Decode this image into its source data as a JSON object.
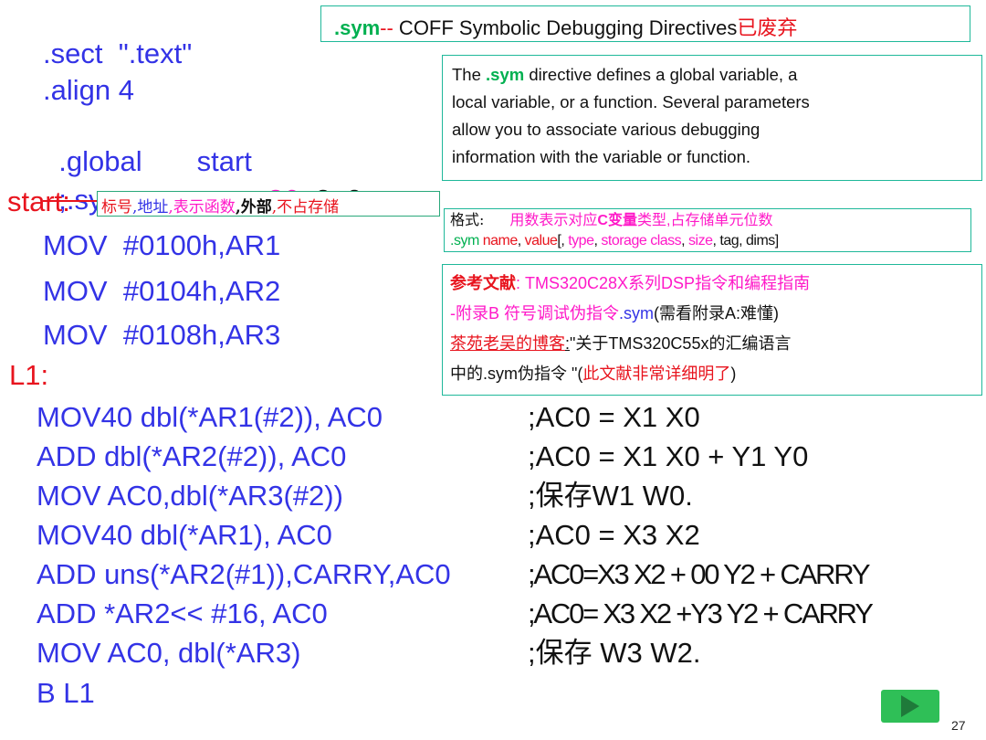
{
  "title_box": {
    "keyword": ".sym",
    "sep": "--",
    "text": " COFF Symbolic Debugging Directives",
    "note": "已废弃"
  },
  "code_top": {
    "sect": ".sect  \".text\"",
    "align": ".align 4",
    "global_kw": ".global",
    "global_arg": "start",
    "sym_kw": ";.sym ",
    "sym_name": "start",
    "sym_c1": ",",
    "sym_value": "start",
    "sym_c2": ", ",
    "sym_type": "36",
    "sym_rest": ", 2, 0"
  },
  "start_label": "start:",
  "annot": {
    "a1": "标号",
    "a2": ",地址",
    "a3": ",表示函数",
    "a4": ",外部",
    "a5": ",不占存储"
  },
  "desc_box": {
    "l1a": "The ",
    "l1k": ".sym",
    "l1b": " directive defines a global variable, a",
    "l2": "local variable, or a function. Several parameters",
    "l3": "allow you to associate various debugging",
    "l4": "information with the variable or function."
  },
  "format_box": {
    "label": "格式:",
    "hint_a": "用数表示对应",
    "hint_b": "C变量",
    "hint_c": "类型",
    "hint_d": ",占存储单元位数",
    "syn_a": ".sym ",
    "syn_b": "name",
    "syn_c": ", ",
    "syn_d": "value",
    "syn_e": "[, ",
    "syn_f": "type",
    "syn_g": ", ",
    "syn_h": "storage class",
    "syn_i": ", ",
    "syn_j": "size",
    "syn_k": ", tag, dims]"
  },
  "ref_box": {
    "r1a": "参考文献",
    "r1b": ": TMS320C28X系列DSP指令和编程指南",
    "r2a": "-附录B 符号调试伪指令",
    "r2b": ".sym",
    "r2c": "(需看附录A:难懂)",
    "r3a": "茶苑老吴的博客",
    "r3b": ":",
    "r3c": "\"关于TMS320C55x的汇编语言",
    "r4a": "中的.sym伪指令 \"(",
    "r4b": "此文献非常详细明了",
    "r4c": ")"
  },
  "mov_lines": [
    "MOV  #0100h,AR1",
    "MOV  #0104h,AR2",
    "MOV  #0108h,AR3"
  ],
  "loop_label": "L1:",
  "instructions": [
    {
      "op": "MOV40 dbl(*AR1(#2)), AC0",
      "comment": ";AC0 = X1 X0"
    },
    {
      "op": "ADD dbl(*AR2(#2)), AC0",
      "comment": ";AC0 = X1 X0 + Y1 Y0"
    },
    {
      "op": "MOV AC0,dbl(*AR3(#2))",
      "comment": ";保存W1 W0."
    },
    {
      "op": "MOV40 dbl(*AR1), AC0",
      "comment": ";AC0 = X3 X2"
    },
    {
      "op": "ADD uns(*AR2(#1)),CARRY,AC0",
      "comment": ";AC0=X3 X2 + 00 Y2 + CARRY"
    },
    {
      "op": "ADD *AR2<< #16, AC0",
      "comment": ";AC0= X3 X2 +Y3 Y2 + CARRY"
    },
    {
      "op": "MOV AC0, dbl(*AR3)",
      "comment": ";保存 W3 W2."
    }
  ],
  "branch": "B L1",
  "page_number": "27",
  "colors": {
    "code_blue": "#3333e6",
    "accent_red": "#e8141e",
    "magenta": "#ff19c8",
    "green": "#00b050",
    "box_border": "#1fb89a"
  }
}
